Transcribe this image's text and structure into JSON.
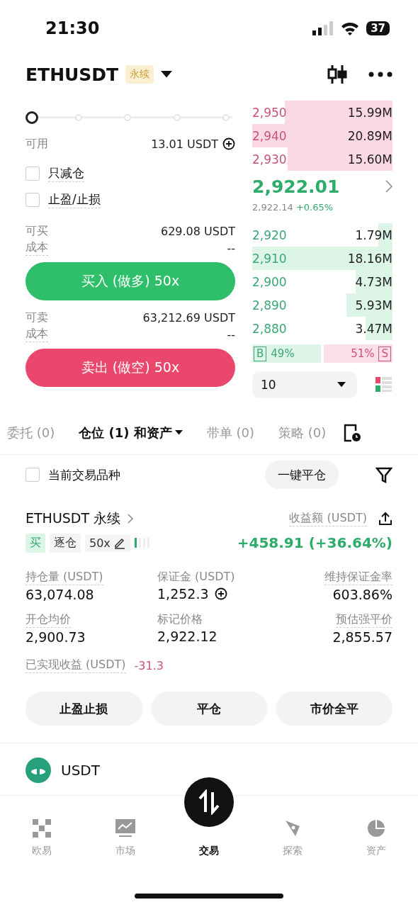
{
  "status_bar": {
    "time": "21:30",
    "battery": "37"
  },
  "header": {
    "symbol": "ETHUSDT",
    "tag": "永续"
  },
  "order_form": {
    "leverage_slider": {
      "level": 0
    },
    "available": {
      "label": "可用",
      "value": "13.01 USDT"
    },
    "options": [
      {
        "label": "只减仓",
        "checked": false
      },
      {
        "label": "止盈/止损",
        "checked": false
      }
    ],
    "buy": {
      "rows": [
        {
          "label": "可买",
          "value": "629.08 USDT"
        },
        {
          "label": "成本",
          "value": "--"
        }
      ],
      "button": "买入 (做多) 50x"
    },
    "sell": {
      "rows": [
        {
          "label": "可卖",
          "value": "63,212.69 USDT"
        },
        {
          "label": "成本",
          "value": "--"
        }
      ],
      "button": "卖出 (做空) 50x"
    }
  },
  "order_book": {
    "asks": [
      {
        "price": "2,950",
        "size": "15.99M"
      },
      {
        "price": "2,940",
        "size": "20.89M"
      },
      {
        "price": "2,930",
        "size": "15.60M"
      }
    ],
    "last_price": "2,922.01",
    "mark_price": "2,922.14",
    "change": "+0.65%",
    "bids": [
      {
        "price": "2,920",
        "size": "1.79M"
      },
      {
        "price": "2,910",
        "size": "18.16M"
      },
      {
        "price": "2,900",
        "size": "4.73M"
      },
      {
        "price": "2,890",
        "size": "5.93M"
      },
      {
        "price": "2,880",
        "size": "3.47M"
      }
    ],
    "ratio": {
      "buy_label": "B",
      "buy_value": "49%",
      "sell_value": "51%",
      "sell_label": "S"
    },
    "depth": "10"
  },
  "tabs": [
    {
      "label": "委托 (0)",
      "selected": false
    },
    {
      "label": "仓位 (1) 和资产",
      "selected": true
    },
    {
      "label": "带单 (0)",
      "selected": false
    },
    {
      "label": "策略 (0)",
      "selected": false
    }
  ],
  "filter": {
    "label": "当前交易品种",
    "checked": false,
    "close_all": "一键平仓"
  },
  "position": {
    "title": "ETHUSDT 永续",
    "pnl_label": "收益额 (USDT)",
    "pnl": "+458.91 (+36.64%)",
    "side": "买",
    "margin_mode": "逐仓",
    "leverage": "50x",
    "stats": [
      {
        "label": "持仓量 (USDT)",
        "value": "63,074.08",
        "kind": "plain"
      },
      {
        "label": "保证金 (USDT)",
        "value": "1,252.3",
        "kind": "add"
      },
      {
        "label": "维持保证金率",
        "value": "603.86%",
        "kind": "plain"
      },
      {
        "label": "开仓均价",
        "value": "2,900.73",
        "kind": "plain"
      },
      {
        "label": "标记价格",
        "value": "2,922.12",
        "kind": "plain"
      },
      {
        "label": "预估强平价",
        "value": "2,855.57",
        "kind": "plain"
      }
    ],
    "realized": {
      "label": "已实现收益 (USDT)",
      "value": "-31.3"
    },
    "buttons": [
      "止盈止损",
      "平仓",
      "市价全平"
    ]
  },
  "asset": {
    "name": "USDT"
  },
  "nav": [
    {
      "label": "欧易",
      "selected": false,
      "kind": "home"
    },
    {
      "label": "市场",
      "selected": false,
      "kind": "market"
    },
    {
      "label": "交易",
      "selected": true,
      "kind": "trade"
    },
    {
      "label": "探索",
      "selected": false,
      "kind": "explore"
    },
    {
      "label": "资产",
      "selected": false,
      "kind": "assets"
    }
  ]
}
